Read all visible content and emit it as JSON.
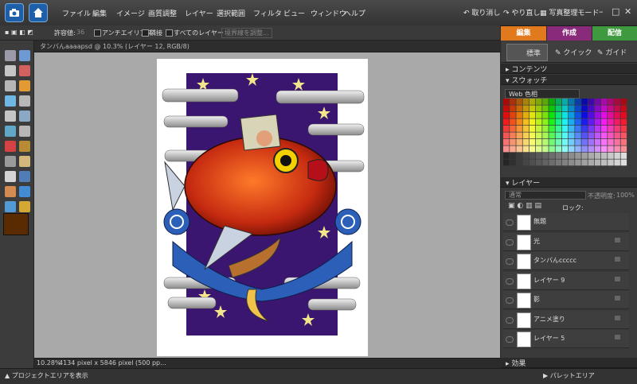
{
  "menu": [
    "ファイル",
    "編集",
    "イメージ",
    "画質調整",
    "レイヤー",
    "選択範囲",
    "フィルタ",
    "ビュー",
    "ウィンドウ",
    "ヘルプ"
  ],
  "titlebar": {
    "undo": "取り消し",
    "redo": "やり直し",
    "organizer": "写真整理モード"
  },
  "options": {
    "tolerance_label": "許容値:",
    "tolerance_value": "36",
    "antialias": "アンチエイリアス",
    "contiguous": "隣接",
    "all_layers": "すべてのレイヤー",
    "refine_edge": "境界線を調整..."
  },
  "mode_tabs": {
    "edit": "編集",
    "create": "作成",
    "share": "配信"
  },
  "edit_modes": {
    "full": "標準",
    "quick": "クイック",
    "guided": "ガイド"
  },
  "document": {
    "title": "タンバんaaaapsd @ 10.3% (レイヤー 12, RGB/8)",
    "zoom": "10.28%",
    "info": "4134 pixel x 5846 pixel (500 pp..."
  },
  "panels": {
    "content": "コンテンツ",
    "swatches": "スウォッチ",
    "swatch_set": "Web 色相",
    "layers": "レイヤー",
    "effects": "効果",
    "blend_mode": "通常",
    "opacity_label": "不透明度:",
    "opacity_value": "100%",
    "lock_label": "ロック:"
  },
  "layers": [
    {
      "name": "無題"
    },
    {
      "name": "光"
    },
    {
      "name": "タンバんccccc"
    },
    {
      "name": "レイヤー 9"
    },
    {
      "name": "影"
    },
    {
      "name": "アニメ塗り"
    },
    {
      "name": "レイヤー 5"
    }
  ],
  "bottom": {
    "project_bin": "プロジェクトエリアを表示",
    "palette_bin": "パレットエリア"
  },
  "colors": {
    "edit_tab": "#e07a1c",
    "create_tab": "#8a2a7a",
    "share_tab": "#3f9a3f",
    "fg_color": "#5a2a00"
  }
}
